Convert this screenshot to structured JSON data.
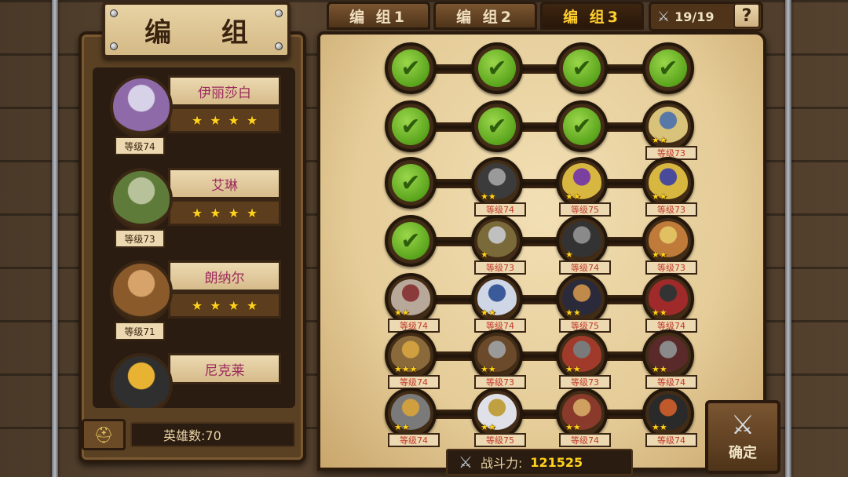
{
  "title": "编 组",
  "tabs": [
    {
      "label": "编 组1",
      "active": false
    },
    {
      "label": "编 组2",
      "active": false
    },
    {
      "label": "编 组3",
      "active": true
    }
  ],
  "token": {
    "icon": "soldier-token-icon",
    "value": "19/19"
  },
  "help_label": "?",
  "heroes": [
    {
      "name": "伊丽莎白",
      "level": "等级74",
      "stars": 4,
      "palette": [
        "#8e6aa8",
        "#d7d2e8"
      ]
    },
    {
      "name": "艾琳",
      "level": "等级73",
      "stars": 4,
      "palette": [
        "#5f7b3a",
        "#b8c29a"
      ]
    },
    {
      "name": "朗纳尔",
      "level": "等级71",
      "stars": 4,
      "palette": [
        "#8a5a2a",
        "#d8a36a"
      ]
    },
    {
      "name": "尼克莱",
      "level": "",
      "stars": 0,
      "palette": [
        "#2f2f2f",
        "#e8b332"
      ]
    }
  ],
  "hero_count": {
    "icon": "helmet-icon",
    "label": "英雄数:70"
  },
  "formation": [
    [
      {
        "type": "check"
      },
      {
        "type": "check"
      },
      {
        "type": "check"
      },
      {
        "type": "check"
      }
    ],
    [
      {
        "type": "check"
      },
      {
        "type": "check"
      },
      {
        "type": "check"
      },
      {
        "type": "hero",
        "stars": 2,
        "level": "等级73",
        "palette": [
          "#d9c27a",
          "#5878a8"
        ]
      }
    ],
    [
      {
        "type": "check"
      },
      {
        "type": "hero",
        "stars": 2,
        "level": "等级74",
        "palette": [
          "#3b3b3b",
          "#9a9a9a"
        ]
      },
      {
        "type": "hero",
        "stars": 2,
        "level": "等级75",
        "palette": [
          "#d8b740",
          "#7b3fa0"
        ]
      },
      {
        "type": "hero",
        "stars": 2,
        "level": "等级73",
        "palette": [
          "#d8b740",
          "#4a4a9a"
        ]
      }
    ],
    [
      {
        "type": "check"
      },
      {
        "type": "hero",
        "stars": 1,
        "level": "等级73",
        "palette": [
          "#7a6a3a",
          "#c0c0c0"
        ]
      },
      {
        "type": "hero",
        "stars": 1,
        "level": "等级74",
        "palette": [
          "#333333",
          "#8a8a8a"
        ]
      },
      {
        "type": "hero",
        "stars": 2,
        "level": "等级73",
        "palette": [
          "#c07a3a",
          "#e0c060"
        ]
      }
    ],
    [
      {
        "type": "hero",
        "stars": 2,
        "level": "等级74",
        "palette": [
          "#b8a89a",
          "#8a3a3a"
        ]
      },
      {
        "type": "hero",
        "stars": 2,
        "level": "等级74",
        "palette": [
          "#cfd6e6",
          "#3a5a9a"
        ]
      },
      {
        "type": "hero",
        "stars": 2,
        "level": "等级75",
        "palette": [
          "#2a2a3a",
          "#c08a4a"
        ]
      },
      {
        "type": "hero",
        "stars": 2,
        "level": "等级74",
        "palette": [
          "#a02a2a",
          "#333333"
        ]
      }
    ],
    [
      {
        "type": "hero",
        "stars": 3,
        "level": "等级74",
        "palette": [
          "#8a6a3a",
          "#d0a040"
        ]
      },
      {
        "type": "hero",
        "stars": 2,
        "level": "等级73",
        "palette": [
          "#6a4a2a",
          "#9a9a9a"
        ]
      },
      {
        "type": "hero",
        "stars": 2,
        "level": "等级73",
        "palette": [
          "#a03a2a",
          "#7a7a7a"
        ]
      },
      {
        "type": "hero",
        "stars": 2,
        "level": "等级74",
        "palette": [
          "#5a2a2a",
          "#8a8a8a"
        ]
      }
    ],
    [
      {
        "type": "hero",
        "stars": 2,
        "level": "等级74",
        "palette": [
          "#7a7a7a",
          "#d0a040"
        ]
      },
      {
        "type": "hero",
        "stars": 2,
        "level": "等级75",
        "palette": [
          "#e0e0e8",
          "#c0a040"
        ]
      },
      {
        "type": "hero",
        "stars": 2,
        "level": "等级74",
        "palette": [
          "#8a3a2a",
          "#d0a060"
        ]
      },
      {
        "type": "hero",
        "stars": 2,
        "level": "等级74",
        "palette": [
          "#2a2a2a",
          "#c05a2a"
        ]
      }
    ]
  ],
  "power": {
    "icon": "crossed-swords-icon",
    "label": "战斗力:",
    "value": "121525"
  },
  "confirm": {
    "icon": "crossed-swords-icon",
    "label": "确定"
  }
}
